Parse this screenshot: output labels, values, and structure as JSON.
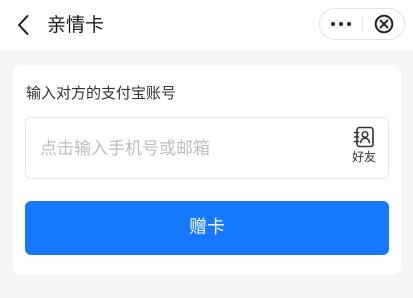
{
  "header": {
    "title": "亲情卡",
    "back_icon": "chevron-left-icon",
    "more_icon": "more-dots-icon",
    "close_icon": "close-circle-icon"
  },
  "form": {
    "label": "输入对方的支付宝账号",
    "input_value": "",
    "input_placeholder": "点击输入手机号或邮箱",
    "friend_label": "好友",
    "friend_icon": "contacts-icon"
  },
  "actions": {
    "submit_label": "赠卡"
  },
  "colors": {
    "accent": "#1677ff",
    "background": "#f5f5f5",
    "card": "#ffffff",
    "placeholder": "#bdbdbd"
  }
}
